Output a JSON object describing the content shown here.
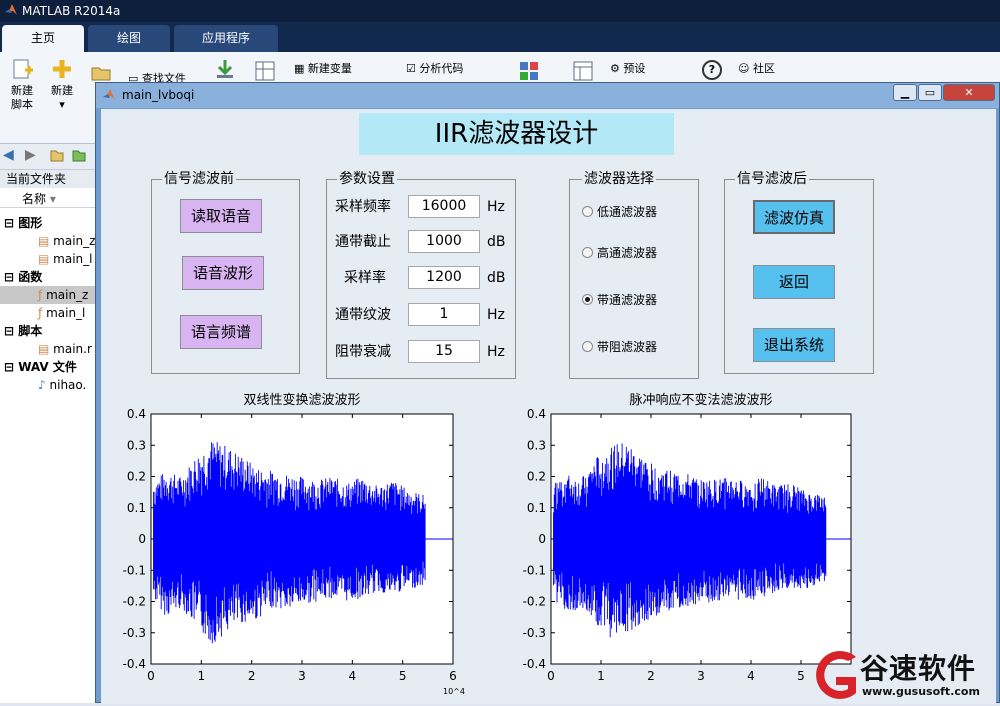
{
  "app": {
    "title": "MATLAB R2014a",
    "tabs": [
      "主页",
      "绘图",
      "应用程序"
    ]
  },
  "ribbon": {
    "new_script": [
      "新建",
      "脚本"
    ],
    "new": "新建",
    "open": "打",
    "find_files": "查找文件",
    "new_variable": "新建变量",
    "analyze_code": "分析代码",
    "preferences": "预设",
    "community": "社区",
    "help_icon": "?"
  },
  "left_panel": {
    "header": "当前文件夹",
    "col_name": "名称",
    "groups": [
      {
        "label": "图形",
        "items": [
          "main_z",
          "main_l"
        ]
      },
      {
        "label": "函数",
        "items": [
          "main_z",
          "main_l"
        ]
      },
      {
        "label": "脚本",
        "items": [
          "main.r"
        ]
      },
      {
        "label": "WAV 文件",
        "items": [
          "nihao."
        ]
      }
    ]
  },
  "figure": {
    "window_title": "main_lvboqi",
    "heading": "IIR滤波器设计",
    "panel_before": {
      "title": "信号滤波前",
      "buttons": [
        "读取语音",
        "语音波形",
        "语言频谱"
      ]
    },
    "panel_params": {
      "title": "参数设置",
      "rows": [
        {
          "label": "采样频率",
          "value": "16000",
          "unit": "Hz"
        },
        {
          "label": "通带截止",
          "value": "1000",
          "unit": "dB"
        },
        {
          "label": "采样率",
          "value": "1200",
          "unit": "dB"
        },
        {
          "label": "通带纹波",
          "value": "1",
          "unit": "Hz"
        },
        {
          "label": "阻带衰减",
          "value": "15",
          "unit": "Hz"
        }
      ]
    },
    "panel_filter": {
      "title": "滤波器选择",
      "options": [
        "低通滤波器",
        "高通滤波器",
        "带通滤波器",
        "带阻滤波器"
      ],
      "selected": "带通滤波器"
    },
    "panel_after": {
      "title": "信号滤波后",
      "buttons": [
        "滤波仿真",
        "返回",
        "退出系统"
      ]
    }
  },
  "colors": {
    "heading_bg": "#b3e9f7",
    "purple_btn": "#d9b4f2",
    "blue_btn": "#56c0ee",
    "wave": "#0000ff"
  },
  "chart_data": [
    {
      "type": "line",
      "title": "双线性变换滤波波形",
      "x_exponent": "10^4",
      "xlim": [
        0,
        6
      ],
      "ylim": [
        -0.4,
        0.4
      ],
      "xticks": [
        "0",
        "1",
        "2",
        "3",
        "4",
        "5",
        "6"
      ],
      "yticks": [
        "0.4",
        "0.3",
        "0.2",
        "0.1",
        "0",
        "-0.1",
        "-0.2",
        "-0.3",
        "-0.4"
      ],
      "signal_end_x": 5.45,
      "envelope_x": [
        0,
        0.3,
        0.6,
        0.9,
        1.2,
        1.5,
        1.8,
        2.1,
        2.4,
        2.7,
        3.0,
        3.3,
        3.6,
        3.9,
        4.2,
        4.5,
        4.8,
        5.1,
        5.45
      ],
      "envelope_upper": [
        0.18,
        0.22,
        0.2,
        0.27,
        0.32,
        0.3,
        0.27,
        0.23,
        0.22,
        0.21,
        0.2,
        0.19,
        0.2,
        0.18,
        0.2,
        0.17,
        0.19,
        0.16,
        0.14
      ],
      "envelope_lower": [
        -0.18,
        -0.25,
        -0.22,
        -0.28,
        -0.34,
        -0.3,
        -0.27,
        -0.26,
        -0.22,
        -0.23,
        -0.21,
        -0.2,
        -0.19,
        -0.2,
        -0.19,
        -0.17,
        -0.18,
        -0.16,
        -0.15
      ]
    },
    {
      "type": "line",
      "title": "脉冲响应不变法滤波波形",
      "xlim": [
        0,
        6
      ],
      "ylim": [
        -0.4,
        0.4
      ],
      "xticks": [
        "0",
        "1",
        "2",
        "3",
        "4",
        "5"
      ],
      "yticks": [
        "0.4",
        "0.3",
        "0.2",
        "0.1",
        "0",
        "-0.1",
        "-0.2",
        "-0.3",
        "-0.4"
      ],
      "signal_end_x": 5.5,
      "envelope_x": [
        0,
        0.3,
        0.6,
        0.9,
        1.2,
        1.5,
        1.8,
        2.1,
        2.4,
        2.7,
        3.0,
        3.3,
        3.6,
        3.9,
        4.2,
        4.5,
        4.8,
        5.1,
        5.5
      ],
      "envelope_upper": [
        0.17,
        0.21,
        0.19,
        0.26,
        0.3,
        0.31,
        0.27,
        0.23,
        0.22,
        0.21,
        0.19,
        0.19,
        0.2,
        0.18,
        0.2,
        0.17,
        0.18,
        0.15,
        0.14
      ],
      "envelope_lower": [
        -0.18,
        -0.24,
        -0.22,
        -0.27,
        -0.32,
        -0.31,
        -0.27,
        -0.26,
        -0.23,
        -0.22,
        -0.21,
        -0.2,
        -0.19,
        -0.2,
        -0.19,
        -0.17,
        -0.17,
        -0.16,
        -0.15
      ]
    }
  ],
  "watermark": {
    "brand": "谷速软件",
    "url": "www.gususoft.com"
  }
}
